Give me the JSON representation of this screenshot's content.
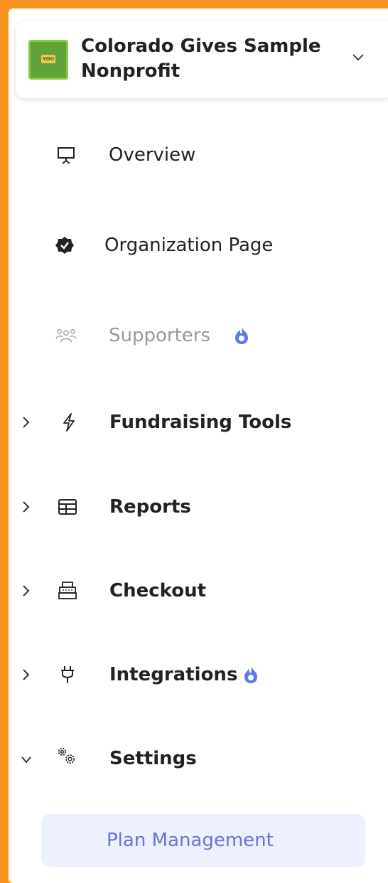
{
  "org": {
    "name": "Colorado Gives Sample Nonprofit",
    "logo_text": "YOU"
  },
  "nav": {
    "overview": "Overview",
    "organization_page": "Organization Page",
    "supporters": "Supporters",
    "fundraising_tools": "Fundraising Tools",
    "reports": "Reports",
    "checkout": "Checkout",
    "integrations": "Integrations",
    "settings": "Settings",
    "plan_management": "Plan Management"
  },
  "colors": {
    "frame": "#F7941D",
    "accent": "#6A73D9",
    "badge": "#5B7BE8",
    "active_bg": "#EDF0FF"
  }
}
